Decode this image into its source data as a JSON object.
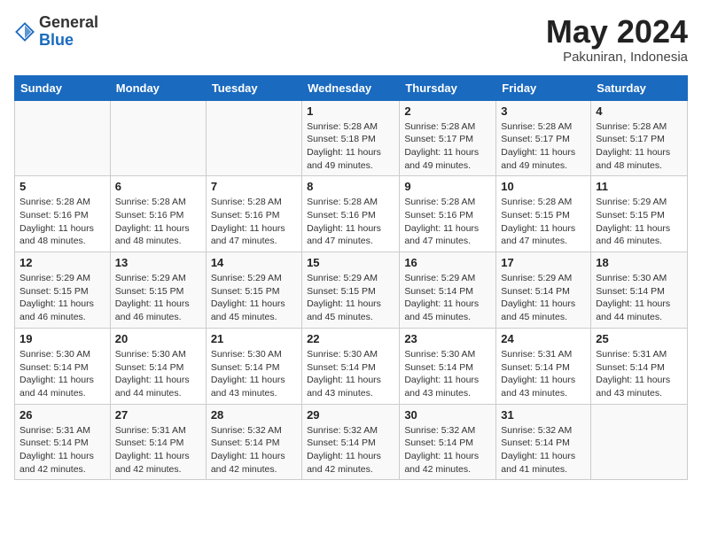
{
  "header": {
    "logo_line1": "General",
    "logo_line2": "Blue",
    "title": "May 2024",
    "subtitle": "Pakuniran, Indonesia"
  },
  "weekdays": [
    "Sunday",
    "Monday",
    "Tuesday",
    "Wednesday",
    "Thursday",
    "Friday",
    "Saturday"
  ],
  "weeks": [
    [
      {
        "day": "",
        "info": ""
      },
      {
        "day": "",
        "info": ""
      },
      {
        "day": "",
        "info": ""
      },
      {
        "day": "1",
        "info": "Sunrise: 5:28 AM\nSunset: 5:18 PM\nDaylight: 11 hours and 49 minutes."
      },
      {
        "day": "2",
        "info": "Sunrise: 5:28 AM\nSunset: 5:17 PM\nDaylight: 11 hours and 49 minutes."
      },
      {
        "day": "3",
        "info": "Sunrise: 5:28 AM\nSunset: 5:17 PM\nDaylight: 11 hours and 49 minutes."
      },
      {
        "day": "4",
        "info": "Sunrise: 5:28 AM\nSunset: 5:17 PM\nDaylight: 11 hours and 48 minutes."
      }
    ],
    [
      {
        "day": "5",
        "info": "Sunrise: 5:28 AM\nSunset: 5:16 PM\nDaylight: 11 hours and 48 minutes."
      },
      {
        "day": "6",
        "info": "Sunrise: 5:28 AM\nSunset: 5:16 PM\nDaylight: 11 hours and 48 minutes."
      },
      {
        "day": "7",
        "info": "Sunrise: 5:28 AM\nSunset: 5:16 PM\nDaylight: 11 hours and 47 minutes."
      },
      {
        "day": "8",
        "info": "Sunrise: 5:28 AM\nSunset: 5:16 PM\nDaylight: 11 hours and 47 minutes."
      },
      {
        "day": "9",
        "info": "Sunrise: 5:28 AM\nSunset: 5:16 PM\nDaylight: 11 hours and 47 minutes."
      },
      {
        "day": "10",
        "info": "Sunrise: 5:28 AM\nSunset: 5:15 PM\nDaylight: 11 hours and 47 minutes."
      },
      {
        "day": "11",
        "info": "Sunrise: 5:29 AM\nSunset: 5:15 PM\nDaylight: 11 hours and 46 minutes."
      }
    ],
    [
      {
        "day": "12",
        "info": "Sunrise: 5:29 AM\nSunset: 5:15 PM\nDaylight: 11 hours and 46 minutes."
      },
      {
        "day": "13",
        "info": "Sunrise: 5:29 AM\nSunset: 5:15 PM\nDaylight: 11 hours and 46 minutes."
      },
      {
        "day": "14",
        "info": "Sunrise: 5:29 AM\nSunset: 5:15 PM\nDaylight: 11 hours and 45 minutes."
      },
      {
        "day": "15",
        "info": "Sunrise: 5:29 AM\nSunset: 5:15 PM\nDaylight: 11 hours and 45 minutes."
      },
      {
        "day": "16",
        "info": "Sunrise: 5:29 AM\nSunset: 5:14 PM\nDaylight: 11 hours and 45 minutes."
      },
      {
        "day": "17",
        "info": "Sunrise: 5:29 AM\nSunset: 5:14 PM\nDaylight: 11 hours and 45 minutes."
      },
      {
        "day": "18",
        "info": "Sunrise: 5:30 AM\nSunset: 5:14 PM\nDaylight: 11 hours and 44 minutes."
      }
    ],
    [
      {
        "day": "19",
        "info": "Sunrise: 5:30 AM\nSunset: 5:14 PM\nDaylight: 11 hours and 44 minutes."
      },
      {
        "day": "20",
        "info": "Sunrise: 5:30 AM\nSunset: 5:14 PM\nDaylight: 11 hours and 44 minutes."
      },
      {
        "day": "21",
        "info": "Sunrise: 5:30 AM\nSunset: 5:14 PM\nDaylight: 11 hours and 43 minutes."
      },
      {
        "day": "22",
        "info": "Sunrise: 5:30 AM\nSunset: 5:14 PM\nDaylight: 11 hours and 43 minutes."
      },
      {
        "day": "23",
        "info": "Sunrise: 5:30 AM\nSunset: 5:14 PM\nDaylight: 11 hours and 43 minutes."
      },
      {
        "day": "24",
        "info": "Sunrise: 5:31 AM\nSunset: 5:14 PM\nDaylight: 11 hours and 43 minutes."
      },
      {
        "day": "25",
        "info": "Sunrise: 5:31 AM\nSunset: 5:14 PM\nDaylight: 11 hours and 43 minutes."
      }
    ],
    [
      {
        "day": "26",
        "info": "Sunrise: 5:31 AM\nSunset: 5:14 PM\nDaylight: 11 hours and 42 minutes."
      },
      {
        "day": "27",
        "info": "Sunrise: 5:31 AM\nSunset: 5:14 PM\nDaylight: 11 hours and 42 minutes."
      },
      {
        "day": "28",
        "info": "Sunrise: 5:32 AM\nSunset: 5:14 PM\nDaylight: 11 hours and 42 minutes."
      },
      {
        "day": "29",
        "info": "Sunrise: 5:32 AM\nSunset: 5:14 PM\nDaylight: 11 hours and 42 minutes."
      },
      {
        "day": "30",
        "info": "Sunrise: 5:32 AM\nSunset: 5:14 PM\nDaylight: 11 hours and 42 minutes."
      },
      {
        "day": "31",
        "info": "Sunrise: 5:32 AM\nSunset: 5:14 PM\nDaylight: 11 hours and 41 minutes."
      },
      {
        "day": "",
        "info": ""
      }
    ]
  ]
}
